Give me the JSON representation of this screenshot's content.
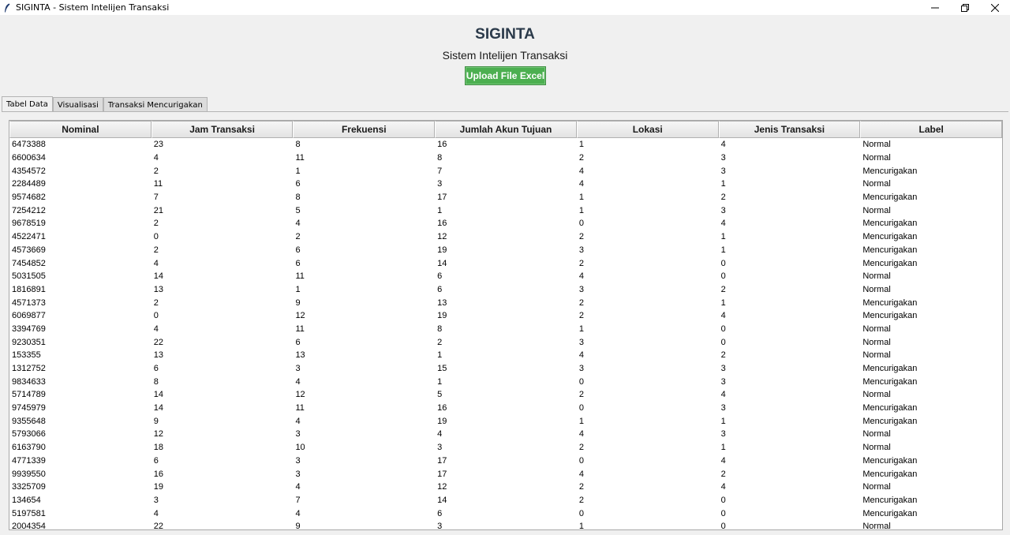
{
  "window": {
    "title": "SIGINTA - Sistem Intelijen Transaksi",
    "icon": "feather-icon",
    "controls": [
      "minimize-icon",
      "restore-icon",
      "close-icon"
    ]
  },
  "header": {
    "title": "SIGINTA",
    "subtitle": "Sistem Intelijen Transaksi",
    "upload_label": "Upload File Excel",
    "upload_color": "#4caf50",
    "title_color": "#2b3a4a"
  },
  "tabs": [
    {
      "label": "Tabel Data",
      "active": true
    },
    {
      "label": "Visualisasi",
      "active": false
    },
    {
      "label": "Transaksi Mencurigakan",
      "active": false
    }
  ],
  "table": {
    "columns": [
      "Nominal",
      "Jam Transaksi",
      "Frekuensi",
      "Jumlah Akun Tujuan",
      "Lokasi",
      "Jenis Transaksi",
      "Label"
    ],
    "rows": [
      [
        "6473388",
        "23",
        "8",
        "16",
        "1",
        "4",
        "Normal"
      ],
      [
        "6600634",
        "4",
        "11",
        "8",
        "2",
        "3",
        "Normal"
      ],
      [
        "4354572",
        "2",
        "1",
        "7",
        "4",
        "3",
        "Mencurigakan"
      ],
      [
        "2284489",
        "11",
        "6",
        "3",
        "4",
        "1",
        "Normal"
      ],
      [
        "9574682",
        "7",
        "8",
        "17",
        "1",
        "2",
        "Mencurigakan"
      ],
      [
        "7254212",
        "21",
        "5",
        "1",
        "1",
        "3",
        "Normal"
      ],
      [
        "9678519",
        "2",
        "4",
        "16",
        "0",
        "4",
        "Mencurigakan"
      ],
      [
        "4522471",
        "0",
        "2",
        "12",
        "2",
        "1",
        "Mencurigakan"
      ],
      [
        "4573669",
        "2",
        "6",
        "19",
        "3",
        "1",
        "Mencurigakan"
      ],
      [
        "7454852",
        "4",
        "6",
        "14",
        "2",
        "0",
        "Mencurigakan"
      ],
      [
        "5031505",
        "14",
        "11",
        "6",
        "4",
        "0",
        "Normal"
      ],
      [
        "1816891",
        "13",
        "1",
        "6",
        "3",
        "2",
        "Normal"
      ],
      [
        "4571373",
        "2",
        "9",
        "13",
        "2",
        "1",
        "Mencurigakan"
      ],
      [
        "6069877",
        "0",
        "12",
        "19",
        "2",
        "4",
        "Mencurigakan"
      ],
      [
        "3394769",
        "4",
        "11",
        "8",
        "1",
        "0",
        "Normal"
      ],
      [
        "9230351",
        "22",
        "6",
        "2",
        "3",
        "0",
        "Normal"
      ],
      [
        "153355",
        "13",
        "13",
        "1",
        "4",
        "2",
        "Normal"
      ],
      [
        "1312752",
        "6",
        "3",
        "15",
        "3",
        "3",
        "Mencurigakan"
      ],
      [
        "9834633",
        "8",
        "4",
        "1",
        "0",
        "3",
        "Mencurigakan"
      ],
      [
        "5714789",
        "14",
        "12",
        "5",
        "2",
        "4",
        "Normal"
      ],
      [
        "9745979",
        "14",
        "11",
        "16",
        "0",
        "3",
        "Mencurigakan"
      ],
      [
        "9355648",
        "9",
        "4",
        "19",
        "1",
        "1",
        "Mencurigakan"
      ],
      [
        "5793066",
        "12",
        "3",
        "4",
        "4",
        "3",
        "Normal"
      ],
      [
        "6163790",
        "18",
        "10",
        "3",
        "2",
        "1",
        "Normal"
      ],
      [
        "4771339",
        "6",
        "3",
        "17",
        "0",
        "4",
        "Mencurigakan"
      ],
      [
        "9939550",
        "16",
        "3",
        "17",
        "4",
        "2",
        "Mencurigakan"
      ],
      [
        "3325709",
        "19",
        "4",
        "12",
        "2",
        "4",
        "Normal"
      ],
      [
        "134654",
        "3",
        "7",
        "14",
        "2",
        "0",
        "Mencurigakan"
      ],
      [
        "5197581",
        "4",
        "4",
        "6",
        "0",
        "0",
        "Mencurigakan"
      ],
      [
        "2004354",
        "22",
        "9",
        "3",
        "1",
        "0",
        "Normal"
      ]
    ]
  }
}
